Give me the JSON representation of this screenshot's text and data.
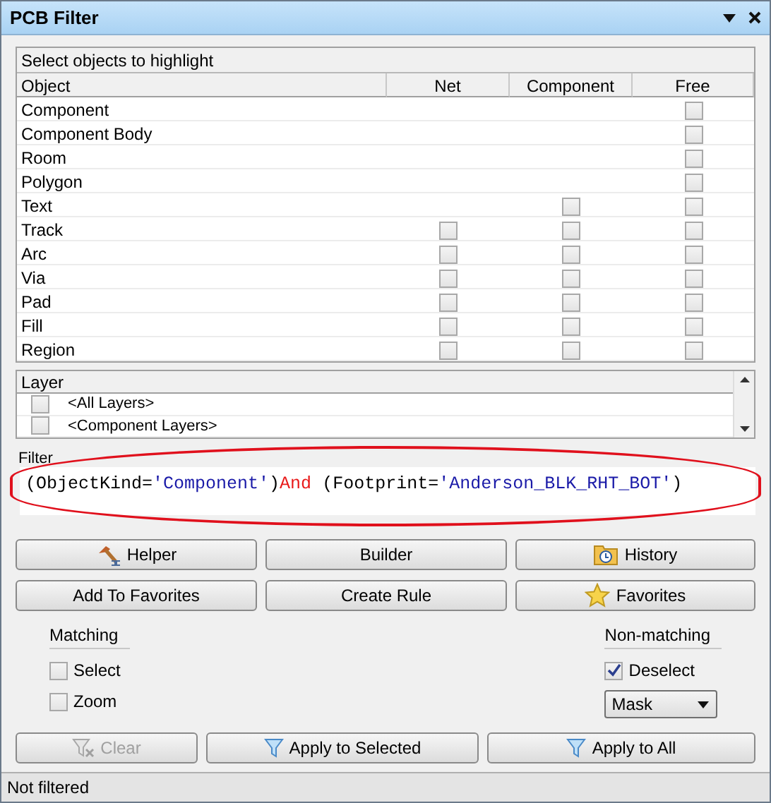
{
  "window": {
    "title": "PCB Filter"
  },
  "objects": {
    "title": "Select objects to highlight",
    "columns": [
      "Object",
      "Net",
      "Component",
      "Free"
    ],
    "rows": [
      {
        "name": "Component",
        "free": false
      },
      {
        "name": "Component Body",
        "free": false
      },
      {
        "name": "Room",
        "free": false
      },
      {
        "name": "Polygon",
        "free": false
      },
      {
        "name": "Text",
        "component": false,
        "free": false
      },
      {
        "name": "Track",
        "net": false,
        "component": false,
        "free": false
      },
      {
        "name": "Arc",
        "net": false,
        "component": false,
        "free": false
      },
      {
        "name": "Via",
        "net": false,
        "component": false,
        "free": false
      },
      {
        "name": "Pad",
        "net": false,
        "component": false,
        "free": false
      },
      {
        "name": "Fill",
        "net": false,
        "component": false,
        "free": false
      },
      {
        "name": "Region",
        "net": false,
        "component": false,
        "free": false
      }
    ]
  },
  "layers": {
    "title": "Layer",
    "rows": [
      {
        "name": "<All Layers>",
        "checked": false
      },
      {
        "name": "<Component Layers>",
        "checked": false
      }
    ]
  },
  "filter": {
    "label": "Filter",
    "tokens": [
      {
        "text": "(ObjectKind=",
        "kind": "plain"
      },
      {
        "text": "'Component'",
        "kind": "string"
      },
      {
        "text": ")",
        "kind": "plain"
      },
      {
        "text": "And",
        "kind": "keyword"
      },
      {
        "text": " (Footprint=",
        "kind": "plain"
      },
      {
        "text": "'Anderson_BLK_RHT_BOT'",
        "kind": "string"
      },
      {
        "text": ")",
        "kind": "plain"
      }
    ],
    "highlighted": true
  },
  "buttons": [
    {
      "label": "Helper",
      "kind": "hammer"
    },
    {
      "label": "Builder",
      "kind": "plain"
    },
    {
      "label": "History",
      "kind": "history"
    },
    {
      "label": "Add To Favorites",
      "kind": "plain"
    },
    {
      "label": "Create Rule",
      "kind": "plain"
    },
    {
      "label": "Favorites",
      "kind": "star"
    }
  ],
  "matching": {
    "title": "Matching",
    "options": [
      {
        "label": "Select",
        "checked": false
      },
      {
        "label": "Zoom",
        "checked": false
      }
    ]
  },
  "non_matching": {
    "title": "Non-matching",
    "options": [
      {
        "label": "Deselect",
        "checked": true
      }
    ],
    "mode": "Mask"
  },
  "actions": [
    {
      "label": "Clear",
      "disabled": true,
      "kind": "clear"
    },
    {
      "label": "Apply to Selected",
      "disabled": false,
      "kind": "filter"
    },
    {
      "label": "Apply to All",
      "disabled": false,
      "kind": "filter"
    }
  ],
  "status_bar": "Not filtered"
}
